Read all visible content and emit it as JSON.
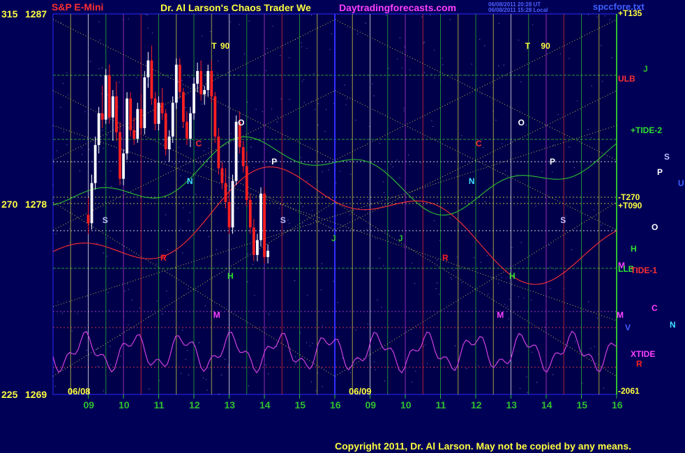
{
  "header": {
    "symbol": "S&P E-Mini",
    "title": "Dr. Al Larson's Chaos Trader We",
    "site": "Daytradingforecasts.com",
    "timestamp1": "06/08/2011 20:28 UT",
    "timestamp2": "06/08/2011 15:28 Local",
    "file": "spccfore.txt"
  },
  "footer": {
    "copyright": "Copyright 2011, Dr. Al Larson. May not be copied by any means."
  },
  "colors": {
    "background": "#000057",
    "price_up": "#ffffff",
    "price_down": "#ff2020",
    "xtide": "#d040e0",
    "tide_green": "#30c030",
    "grid": "#e0e040"
  },
  "chart_data": {
    "type": "candlestick",
    "y_axis": {
      "ticks": [
        {
          "angle": "315",
          "price": "1287"
        },
        {
          "angle": "270",
          "price": "1278"
        },
        {
          "angle": "225",
          "price": "1269"
        }
      ],
      "ylim": [
        1269,
        1287
      ]
    },
    "x_axis": {
      "dates": [
        "06/08",
        "06/09"
      ],
      "hour_ticks_day1": [
        "09",
        "10",
        "11",
        "12",
        "13",
        "14",
        "15",
        "16"
      ],
      "hour_ticks_day2": [
        "09",
        "10",
        "11",
        "12",
        "13",
        "14",
        "15",
        "16"
      ]
    },
    "right_labels": [
      "+T135",
      "ULB",
      "J",
      "+TIDE-2",
      "S",
      "P",
      "U",
      "-T270",
      "+T090",
      "O",
      "H",
      "M",
      "LLB",
      "TIDE-1",
      "C",
      "N",
      "V",
      "XTIDE",
      "R",
      "-2061"
    ],
    "flux_labels": [
      {
        "text": "T",
        "hour": 12.5
      },
      {
        "text": "90",
        "hour": 12.75
      },
      {
        "text": "O",
        "hour": 13.25
      },
      {
        "text": "P",
        "hour": 14.2
      },
      {
        "text": "S",
        "hour": 14.45
      },
      {
        "text": "C",
        "hour": 12.05
      },
      {
        "text": "N",
        "hour": 11.8
      },
      {
        "text": "H",
        "hour": 12.95
      },
      {
        "text": "M",
        "hour": 12.55
      },
      {
        "text": "R",
        "hour": 11.05
      },
      {
        "text": "S",
        "hour": 9.4
      },
      {
        "text": "J",
        "hour": 15.9
      },
      {
        "text": "T",
        "day": 2,
        "hour": 13.4
      },
      {
        "text": "90",
        "day": 2,
        "hour": 13.85
      },
      {
        "text": "O",
        "day": 2,
        "hour": 13.2
      },
      {
        "text": "P",
        "day": 2,
        "hour": 14.1
      },
      {
        "text": "S",
        "day": 2,
        "hour": 14.4
      },
      {
        "text": "C",
        "day": 2,
        "hour": 12.0
      },
      {
        "text": "N",
        "day": 2,
        "hour": 11.8
      },
      {
        "text": "H",
        "day": 2,
        "hour": 12.95
      },
      {
        "text": "M",
        "day": 2,
        "hour": 12.6
      },
      {
        "text": "R",
        "day": 2,
        "hour": 11.05
      },
      {
        "text": "J",
        "day": 2,
        "hour": 9.8
      },
      {
        "text": "M",
        "day": 2,
        "hour": 16.0
      }
    ],
    "candles": [
      [
        9.0,
        1277.5,
        1278.3,
        1276.6,
        1277.1
      ],
      [
        9.1,
        1277.1,
        1279.4,
        1276.8,
        1279.0
      ],
      [
        9.2,
        1279.0,
        1281.2,
        1278.7,
        1280.8
      ],
      [
        9.3,
        1280.8,
        1282.6,
        1280.4,
        1282.3
      ],
      [
        9.4,
        1282.3,
        1283.6,
        1281.6,
        1282.0
      ],
      [
        9.5,
        1282.0,
        1284.4,
        1281.8,
        1284.1
      ],
      [
        9.6,
        1284.1,
        1284.6,
        1281.8,
        1282.1
      ],
      [
        9.7,
        1282.1,
        1283.4,
        1281.0,
        1283.1
      ],
      [
        9.8,
        1283.1,
        1283.8,
        1281.0,
        1281.4
      ],
      [
        9.9,
        1281.4,
        1281.9,
        1278.9,
        1279.2
      ],
      [
        10.0,
        1279.2,
        1280.6,
        1278.9,
        1280.4
      ],
      [
        10.1,
        1280.4,
        1283.3,
        1280.1,
        1283.0
      ],
      [
        10.2,
        1283.0,
        1283.3,
        1281.2,
        1281.5
      ],
      [
        10.3,
        1281.5,
        1282.1,
        1280.8,
        1281.1
      ],
      [
        10.4,
        1281.1,
        1282.8,
        1280.9,
        1282.5
      ],
      [
        10.5,
        1282.5,
        1283.2,
        1281.3,
        1281.6
      ],
      [
        10.6,
        1281.6,
        1284.3,
        1281.3,
        1284.0
      ],
      [
        10.7,
        1284.0,
        1285.2,
        1283.5,
        1284.8
      ],
      [
        10.8,
        1284.8,
        1285.5,
        1282.7,
        1283.0
      ],
      [
        10.9,
        1283.0,
        1283.3,
        1281.5,
        1281.8
      ],
      [
        11.0,
        1281.8,
        1283.1,
        1281.5,
        1282.8
      ],
      [
        11.1,
        1282.8,
        1283.5,
        1282.0,
        1282.3
      ],
      [
        11.2,
        1282.3,
        1282.5,
        1280.3,
        1280.6
      ],
      [
        11.3,
        1280.6,
        1281.5,
        1280.0,
        1281.2
      ],
      [
        11.4,
        1281.2,
        1283.1,
        1280.9,
        1282.8
      ],
      [
        11.5,
        1282.8,
        1284.9,
        1282.5,
        1284.6
      ],
      [
        11.6,
        1284.6,
        1284.9,
        1283.0,
        1283.3
      ],
      [
        11.7,
        1283.3,
        1283.5,
        1281.6,
        1281.9
      ],
      [
        11.8,
        1281.9,
        1282.4,
        1280.8,
        1281.1
      ],
      [
        11.9,
        1281.1,
        1282.6,
        1280.7,
        1282.3
      ],
      [
        12.0,
        1282.3,
        1284.0,
        1282.0,
        1283.7
      ],
      [
        12.1,
        1283.7,
        1284.7,
        1283.3,
        1284.3
      ],
      [
        12.2,
        1284.3,
        1284.8,
        1282.9,
        1283.2
      ],
      [
        12.3,
        1283.2,
        1283.6,
        1282.7,
        1283.4
      ],
      [
        12.4,
        1283.4,
        1284.6,
        1283.1,
        1284.3
      ],
      [
        12.5,
        1284.3,
        1284.8,
        1282.8,
        1283.1
      ],
      [
        12.6,
        1283.1,
        1283.3,
        1280.9,
        1281.2
      ],
      [
        12.7,
        1281.2,
        1281.6,
        1279.4,
        1279.7
      ],
      [
        12.8,
        1279.7,
        1280.0,
        1278.7,
        1279.0
      ],
      [
        12.9,
        1279.0,
        1279.7,
        1277.8,
        1278.1
      ],
      [
        13.0,
        1278.1,
        1278.6,
        1276.6,
        1276.9
      ],
      [
        13.1,
        1276.9,
        1279.4,
        1276.6,
        1279.1
      ],
      [
        13.2,
        1279.1,
        1282.2,
        1278.9,
        1281.9
      ],
      [
        13.3,
        1281.9,
        1282.4,
        1280.4,
        1280.7
      ],
      [
        13.4,
        1280.7,
        1281.0,
        1279.5,
        1279.8
      ],
      [
        13.5,
        1279.8,
        1280.5,
        1277.9,
        1278.2
      ],
      [
        13.6,
        1278.2,
        1278.5,
        1276.6,
        1276.9
      ],
      [
        13.7,
        1276.9,
        1277.3,
        1275.3,
        1275.6
      ],
      [
        13.8,
        1275.6,
        1276.6,
        1275.3,
        1276.3
      ],
      [
        13.9,
        1276.3,
        1278.8,
        1276.0,
        1278.5
      ],
      [
        14.0,
        1278.5,
        1278.8,
        1275.2,
        1275.5
      ],
      [
        14.1,
        1275.5,
        1276.1,
        1275.2,
        1275.8
      ]
    ]
  }
}
